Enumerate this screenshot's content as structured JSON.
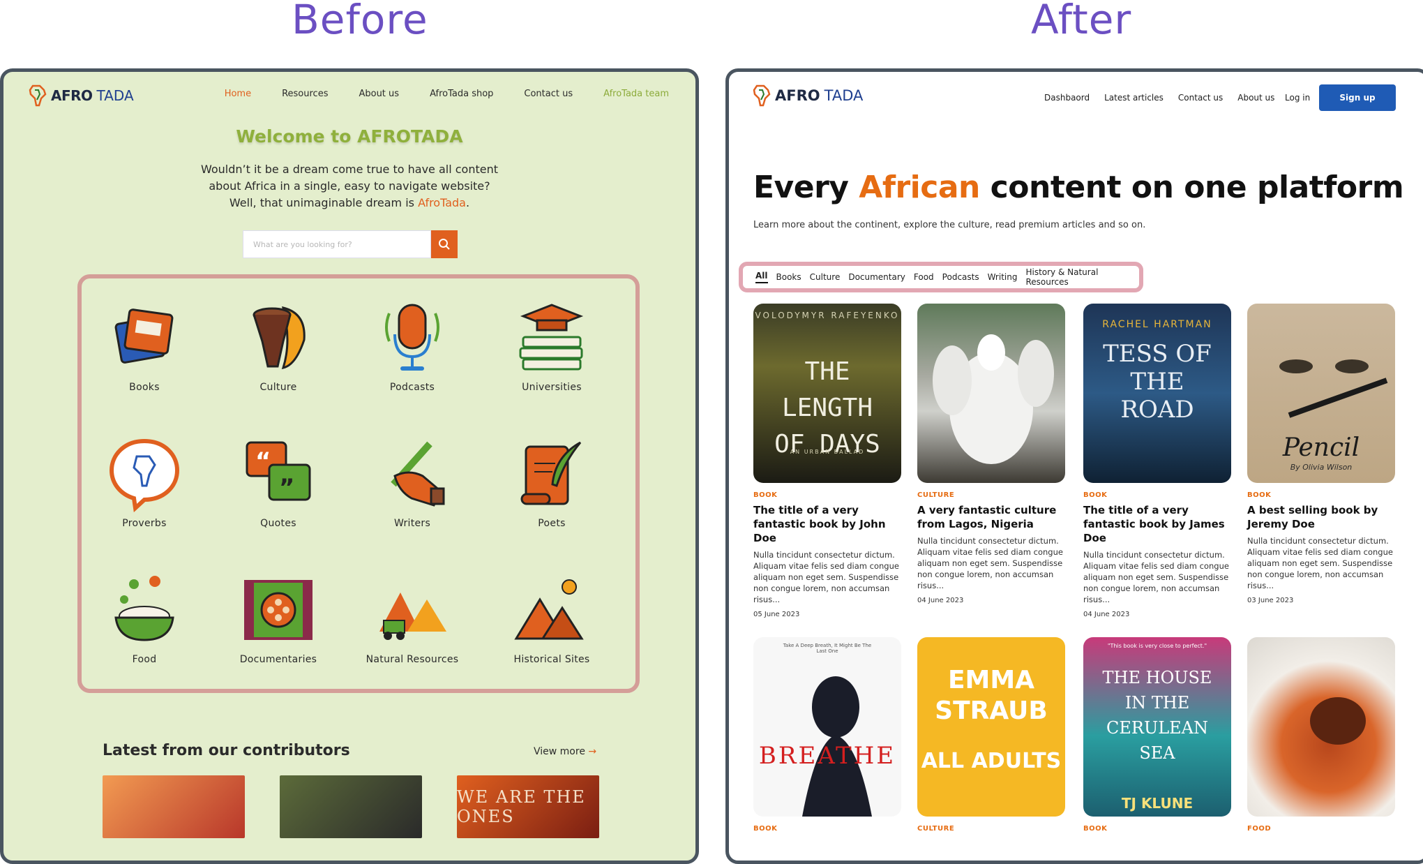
{
  "headings": {
    "before": "Before",
    "after": "After"
  },
  "before": {
    "logo": {
      "part1": "AFRO",
      "part2": "TADA"
    },
    "nav": [
      "Home",
      "Resources",
      "About us",
      "AfroTada shop",
      "Contact us",
      "AfroTada team"
    ],
    "title": "Welcome to AFROTADA",
    "intro": {
      "line1": "Wouldn’t it be a dream come true to have all content",
      "line2": "about Africa in a single, easy to navigate website?",
      "line3_prefix": "Well, that unimaginable dream is ",
      "line3_accent": "AfroTada",
      "line3_suffix": "."
    },
    "search": {
      "placeholder": "What are you looking for?"
    },
    "categories": [
      "Books",
      "Culture",
      "Podcasts",
      "Universities",
      "Proverbs",
      "Quotes",
      "Writers",
      "Poets",
      "Food",
      "Documentaries",
      "Natural Resources",
      "Historical Sites"
    ],
    "latest_title": "Latest from our contributors",
    "view_more": "View more",
    "thumb3_text": "WE ARE THE ONES"
  },
  "after": {
    "logo": {
      "part1": "AFRO",
      "part2": "TADA"
    },
    "nav": [
      "Dashbaord",
      "Latest articles",
      "Contact us",
      "About us"
    ],
    "login": "Log in",
    "signup": "Sign up",
    "headline": {
      "pre": "Every ",
      "accent": "African",
      "post": " content on one platform"
    },
    "subtitle": "Learn more about the continent, explore the culture, read premium articles and so on.",
    "tabs": [
      "All",
      "Books",
      "Culture",
      "Documentary",
      "Food",
      "Podcasts",
      "Writing",
      "History & Natural Resources"
    ],
    "cards": [
      {
        "category": "BOOK",
        "title": "The title of  a very fantastic book by John Doe",
        "desc": "Nulla tincidunt consectetur dictum. Aliquam vitae felis sed diam congue aliquam non eget sem. Suspendisse non congue lorem, non accumsan risus...",
        "date": "05 June 2023",
        "cover_top": "VOLODYMYR RAFEYENKO",
        "cover_main": "THE LENGTH OF DAYS",
        "cover_sub": "AN URBAN BALLAD"
      },
      {
        "category": "CULTURE",
        "title": "A very fantastic culture from Lagos, Nigeria",
        "desc": "Nulla tincidunt consectetur dictum. Aliquam vitae felis sed diam congue aliquam non eget sem. Suspendisse non congue lorem, non accumsan risus...",
        "date": "04 June 2023"
      },
      {
        "category": "BOOK",
        "title": "The title of  a very fantastic book by James Doe",
        "desc": "Nulla tincidunt consectetur dictum. Aliquam vitae felis sed diam congue aliquam non eget sem. Suspendisse non congue lorem, non accumsan risus...",
        "date": "04 June 2023",
        "cover_top": "RACHEL HARTMAN",
        "cover_main": "TESS OF THE ROAD"
      },
      {
        "category": "BOOK",
        "title": "A best selling book by Jeremy Doe",
        "desc": "Nulla tincidunt consectetur dictum. Aliquam vitae felis sed diam congue aliquam non eget sem. Suspendisse non congue lorem, non accumsan risus...",
        "date": "03 June 2023",
        "cover_main": "Pencil",
        "cover_sub": "By Olivia Wilson"
      }
    ],
    "row2": [
      {
        "category": "BOOK",
        "cover_main": "BREATHE",
        "cover_top": "Take A Deep Breath, It Might Be The Last One"
      },
      {
        "category": "CULTURE",
        "cover_main": "EMMA STRAUB",
        "cover_sub": "ALL ADULTS"
      },
      {
        "category": "BOOK",
        "cover_main": "THE HOUSE IN THE CERULEAN SEA",
        "cover_sub": "TJ KLUNE",
        "cover_top": "\"This book is very close to perfect.\""
      },
      {
        "category": "FOOD"
      }
    ]
  }
}
